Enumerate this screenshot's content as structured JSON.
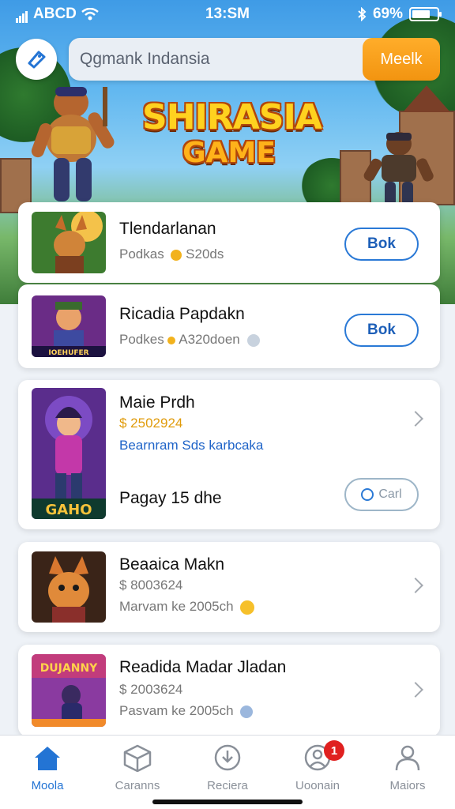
{
  "status_bar": {
    "carrier": "ABCD",
    "time": "13:SM",
    "battery": "69%"
  },
  "search": {
    "placeholder": "Qgmank Indansia",
    "button_label": "Meelk"
  },
  "hero": {
    "title_line1": "SHIRASIA",
    "title_line2": "GAME"
  },
  "cards": [
    {
      "title": "Tlendarlanan",
      "subtitle": "Podkas",
      "meta": "S20ds",
      "action": "Bok"
    },
    {
      "title": "Ricadia Papdakn",
      "subtitle": "Podkes",
      "meta": "A320doen",
      "action": "Bok",
      "thumb_caption": "IOEHUFER"
    },
    {
      "title": "Maie Prdh",
      "price": "$ 2502924",
      "link": "Bearnram Sds  karbcaka",
      "footer": "Pagay 15  dhe",
      "action": "Carl",
      "thumb_caption": "GAHO"
    },
    {
      "title": "Beaaica Makn",
      "price": "$ 8003624",
      "detail": "Marvam ke 2005ch"
    },
    {
      "title": "Readida Madar Jladan",
      "price": "$ 2003624",
      "detail": "Pasvam ke 2005ch",
      "thumb_caption": "DUJANNY"
    }
  ],
  "tabs": [
    {
      "label": "Moola",
      "icon": "home-icon",
      "active": true
    },
    {
      "label": "Caranns",
      "icon": "cube-icon"
    },
    {
      "label": "Reciera",
      "icon": "download-icon"
    },
    {
      "label": "Uoonain",
      "icon": "person-icon",
      "badge": "1"
    },
    {
      "label": "Maiors",
      "icon": "profile-icon"
    }
  ],
  "colors": {
    "accent": "#2374d4",
    "search_button": "#f59a14",
    "badge": "#e0201f",
    "price": "#e09b0a"
  }
}
